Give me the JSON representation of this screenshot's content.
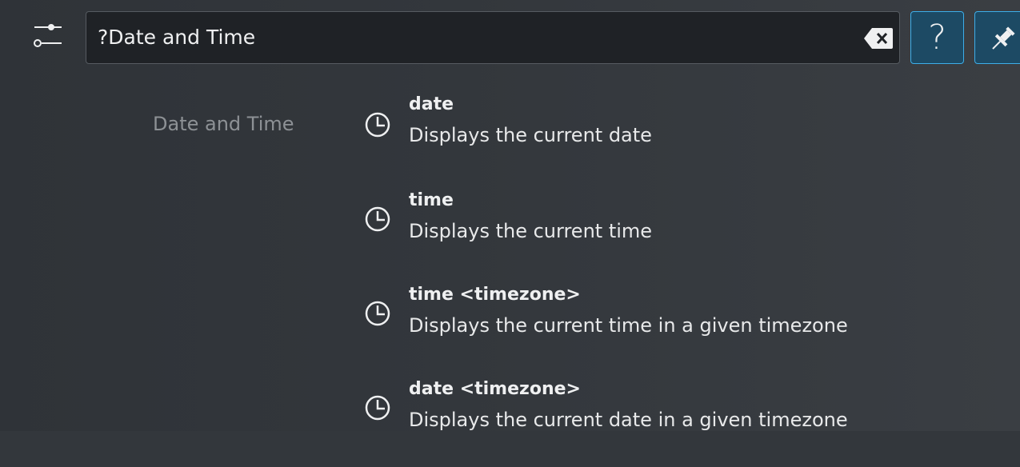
{
  "search": {
    "query": "?Date and Time"
  },
  "buttons": {
    "help_label": "?"
  },
  "results": {
    "category": "Date and Time",
    "items": [
      {
        "title": "date",
        "subtitle": "Displays the current date",
        "icon": "clock-icon"
      },
      {
        "title": "time",
        "subtitle": "Displays the current time",
        "icon": "clock-icon"
      },
      {
        "title": "time <timezone>",
        "subtitle": "Displays the current time in a given timezone",
        "icon": "clock-icon"
      },
      {
        "title": "date <timezone>",
        "subtitle": "Displays the current date in a given timezone",
        "icon": "clock-icon"
      }
    ]
  },
  "colors": {
    "background": "#33373c",
    "search_background": "#1f2226",
    "accent": "#3daee9",
    "text": "#eff0f1",
    "muted_text": "#8d9195"
  },
  "icons": {
    "config": "sliders-icon",
    "clear": "backspace-clear-icon",
    "help": "question-mark",
    "pin": "pin-icon"
  }
}
